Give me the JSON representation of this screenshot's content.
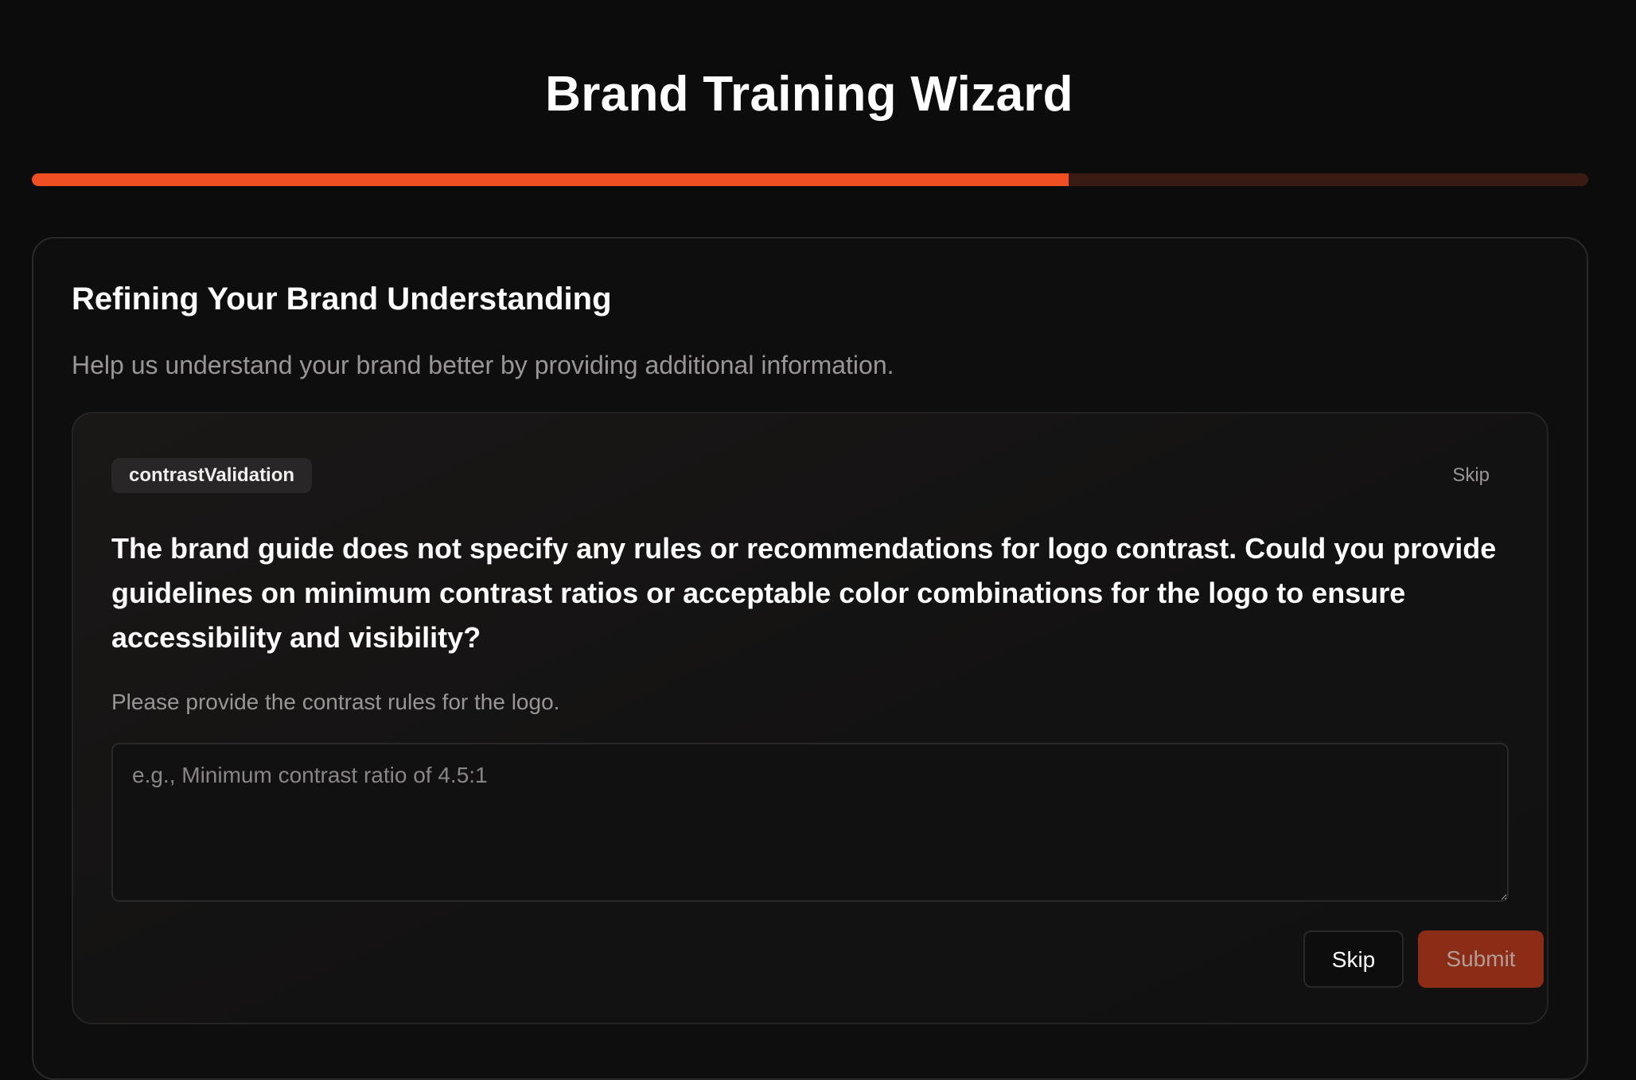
{
  "header": {
    "title": "Brand Training Wizard"
  },
  "progress": {
    "fraction": 0.666,
    "fill_color": "#f04e23",
    "track_color": "#3a1b13"
  },
  "section": {
    "title": "Refining Your Brand Understanding",
    "description": "Help us understand your brand better by providing additional information."
  },
  "question": {
    "tag": "contrastValidation",
    "skip_link_label": "Skip",
    "text": "The brand guide does not specify any rules or recommendations for logo contrast. Could you provide guidelines on minimum contrast ratios or acceptable color combinations for the logo to ensure accessibility and visibility?",
    "prompt": "Please provide the contrast rules for the logo.",
    "input_value": "",
    "input_placeholder": "e.g., Minimum contrast ratio of 4.5:1"
  },
  "actions": {
    "skip_label": "Skip",
    "submit_label": "Submit",
    "submit_color": "#8a2c16"
  }
}
